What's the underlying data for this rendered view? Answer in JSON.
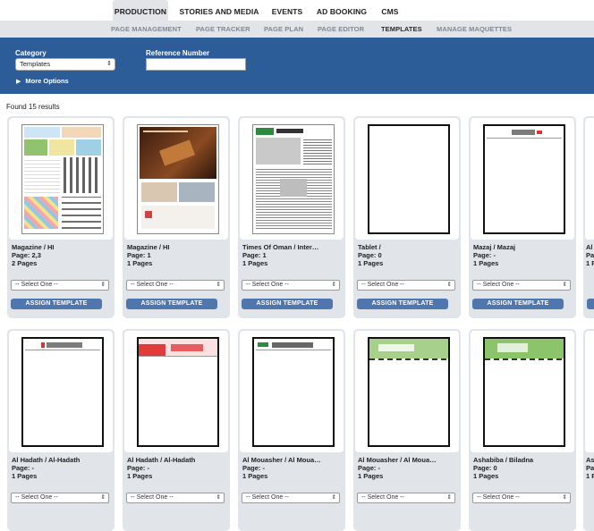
{
  "topnav": {
    "items": [
      {
        "label": "PRODUCTION",
        "active": true
      },
      {
        "label": "STORIES AND MEDIA",
        "active": false
      },
      {
        "label": "EVENTS",
        "active": false
      },
      {
        "label": "AD BOOKING",
        "active": false
      },
      {
        "label": "CMS",
        "active": false
      }
    ]
  },
  "subnav": {
    "items": [
      {
        "label": "PAGE MANAGEMENT",
        "active": false
      },
      {
        "label": "PAGE TRACKER",
        "active": false
      },
      {
        "label": "PAGE PLAN",
        "active": false
      },
      {
        "label": "PAGE EDITOR",
        "active": false
      },
      {
        "label": "TEMPLATES",
        "active": true
      },
      {
        "label": "MANAGE MAQUETTES",
        "active": false
      }
    ]
  },
  "filters": {
    "category_label": "Category",
    "category_value": "Templates",
    "reference_label": "Reference Number",
    "reference_value": "",
    "more_options": "More Options"
  },
  "results": {
    "found_text": "Found 15 results",
    "select_placeholder": "-- Select One --",
    "assign_label": "ASSIGN TEMPLATE",
    "cards": [
      {
        "title": "Magazine / HI",
        "pages": "Page: 2,3",
        "count": "2 Pages",
        "thumb": "puzzle"
      },
      {
        "title": "Magazine / HI",
        "pages": "Page: 1",
        "count": "1 Pages",
        "thumb": "ad"
      },
      {
        "title": "Times Of Oman / Inter…",
        "pages": "Page: 1",
        "count": "1 Pages",
        "thumb": "newspaper"
      },
      {
        "title": "Tablet /",
        "pages": "Page: 0",
        "count": "1 Pages",
        "thumb": "blank"
      },
      {
        "title": "Mazaj / Mazaj",
        "pages": "Page: -",
        "count": "1 Pages",
        "thumb": "masthead"
      },
      {
        "title": "Al",
        "pages": "Pa",
        "count": "1 P",
        "thumb": "partial"
      },
      {
        "title": "Al Hadath / Al-Hadath",
        "pages": "Page: -",
        "count": "1 Pages",
        "thumb": "masthead"
      },
      {
        "title": "Al Hadath / Al-Hadath",
        "pages": "Page: -",
        "count": "1 Pages",
        "thumb": "redhead"
      },
      {
        "title": "Al Mouasher / Al Moua…",
        "pages": "Page: -",
        "count": "1 Pages",
        "thumb": "masthead-green"
      },
      {
        "title": "Al Mouasher / Al Moua…",
        "pages": "Page: -",
        "count": "1 Pages",
        "thumb": "greenhead"
      },
      {
        "title": "Ashabiba / Biladna",
        "pages": "Page: 0",
        "count": "1 Pages",
        "thumb": "greenhead"
      },
      {
        "title": "Ash",
        "pages": "Pag",
        "count": "1 P",
        "thumb": "partial"
      }
    ]
  },
  "colors": {
    "nav_bg": "#e2e4e8",
    "filter_bar": "#2d5d99",
    "assign_button": "#4f77ad",
    "card_bg": "#e1e4e9"
  }
}
